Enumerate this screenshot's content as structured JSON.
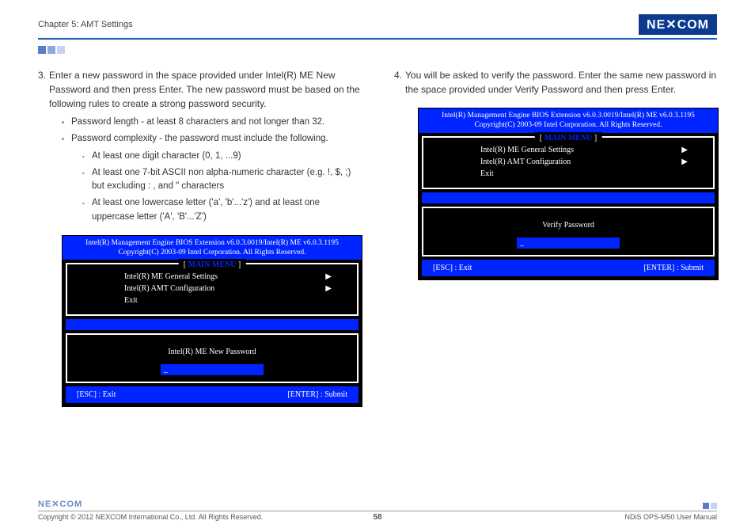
{
  "header": {
    "chapter": "Chapter 5: AMT Settings",
    "logo": "NE COM",
    "logo_x": "X"
  },
  "left": {
    "step_num": "3.",
    "step_text": "Enter a new password in the space provided under Intel(R) ME New Password and then press Enter. The new password must be based on the following rules to create a strong password security.",
    "b1": "Password length - at least 8 characters and not longer than 32.",
    "b2": "Password complexity - the password must include the following.",
    "s1": "At least one digit character (0, 1, ...9)",
    "s2": "At least one 7-bit ASCII non alpha-numeric character (e.g. !, $, ;) but excluding : , and \" characters",
    "s3": "At least one lowercase letter ('a', 'b'...'z') and at least one uppercase letter ('A', 'B'...'Z')"
  },
  "right": {
    "step_num": "4.",
    "step_text": "You will be asked to verify the password. Enter the same new password in the space provided under Verify Password and then press Enter."
  },
  "bios": {
    "header1": "Intel(R) Management Engine BIOS Extension v6.0.3.0019/Intel(R) ME v6.0.3.1195",
    "header2": "Copyright(C) 2003-09 Intel Corporation. All Rights Reserved.",
    "menu_title": "MAIN MENU",
    "m1": "Intel(R) ME General Settings",
    "m2": "Intel(R) AMT Configuration",
    "m3": "Exit",
    "arrow": "▶",
    "pw1": "Intel(R) ME New Password",
    "pw2": "Verify Password",
    "cursor": "_",
    "esc": "[ESC] : Exit",
    "enter": "[ENTER] : Submit"
  },
  "footer": {
    "logo": "NE COM",
    "copyright": "Copyright © 2012 NEXCOM International Co., Ltd. All Rights Reserved.",
    "page": "58",
    "manual": "NDiS OPS-M50 User Manual"
  }
}
